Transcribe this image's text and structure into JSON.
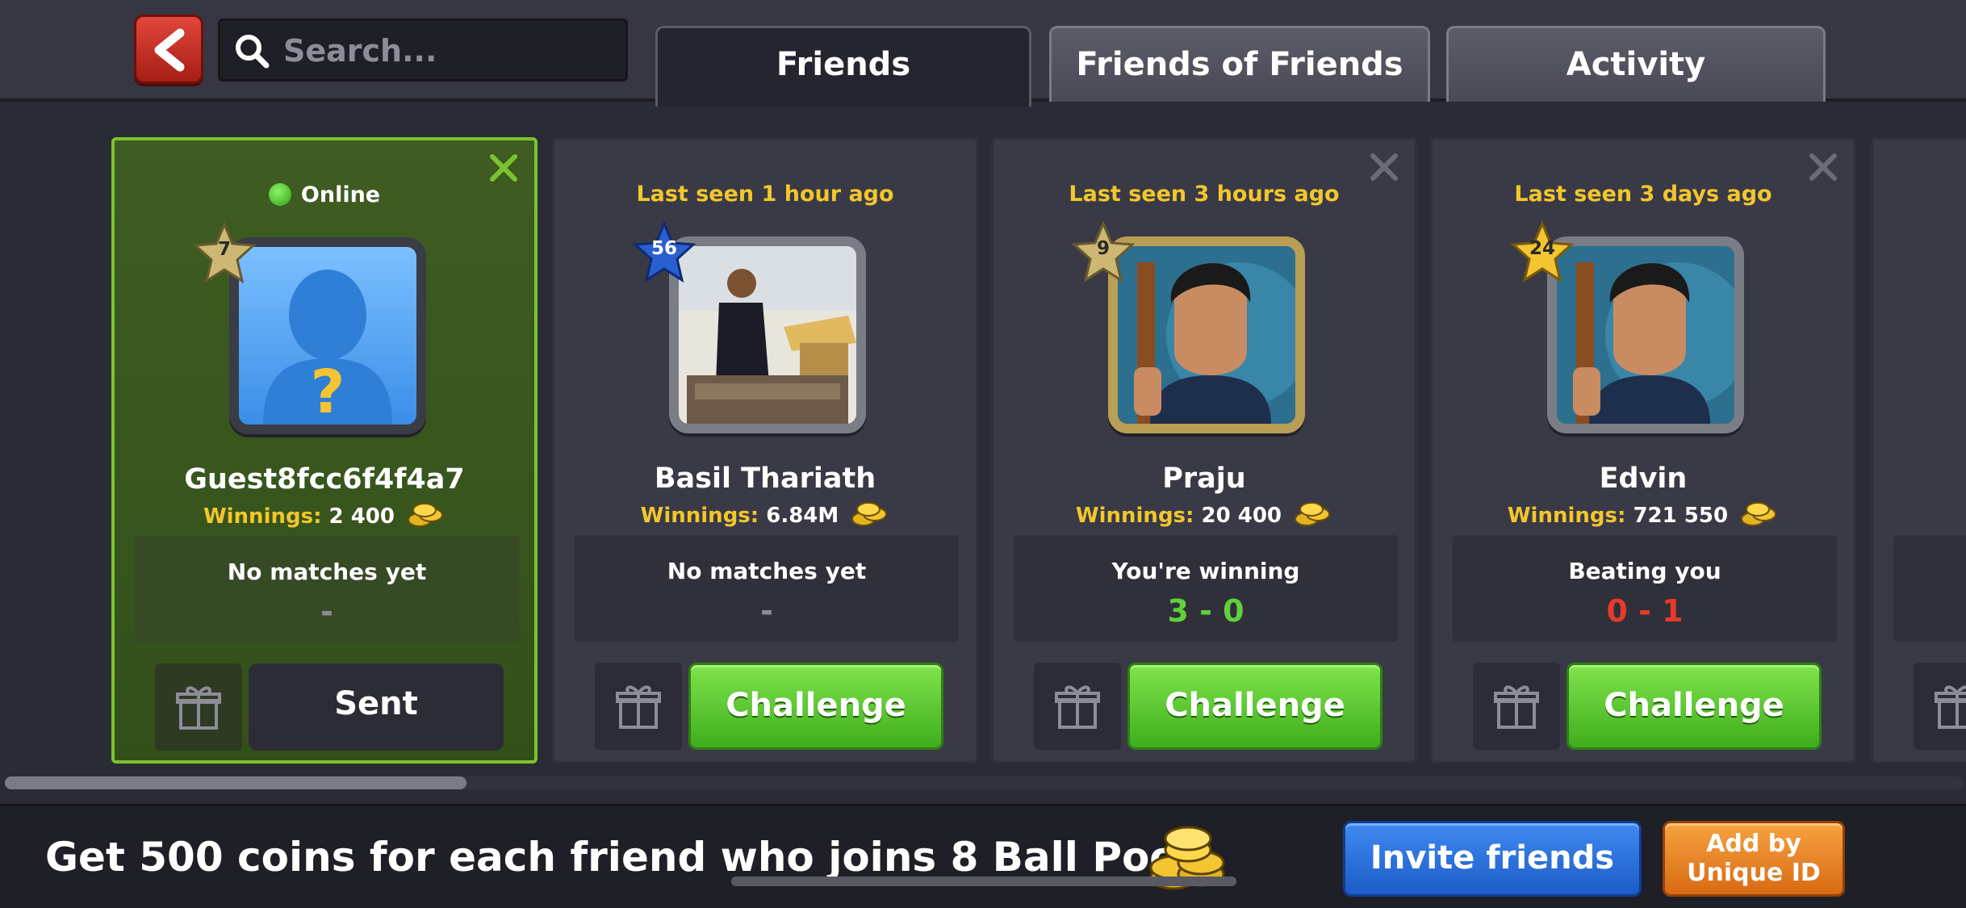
{
  "header": {
    "search_placeholder": "Search...",
    "tabs": [
      {
        "label": "Friends",
        "active": true
      },
      {
        "label": "Friends of Friends",
        "active": false
      },
      {
        "label": "Activity",
        "active": false
      }
    ]
  },
  "winnings_label": "Winnings:",
  "friends": [
    {
      "status": "Online",
      "online": true,
      "level": "7",
      "name": "Guest8fcc6f4f4a7",
      "winnings": "2 400",
      "record_text": "No matches yet",
      "record_score": "-",
      "action_label": "Sent"
    },
    {
      "status": "Last seen 1 hour ago",
      "online": false,
      "level": "56",
      "name": "Basil Thariath",
      "winnings": "6.84M",
      "record_text": "No matches yet",
      "record_score": "-",
      "action_label": "Challenge"
    },
    {
      "status": "Last seen 3 hours ago",
      "online": false,
      "level": "9",
      "name": "Praju",
      "winnings": "20 400",
      "record_text": "You're winning",
      "record_score": "3 - 0",
      "action_label": "Challenge"
    },
    {
      "status": "Last seen 3 days ago",
      "online": false,
      "level": "24",
      "name": "Edvin",
      "winnings": "721 550",
      "record_text": "Beating you",
      "record_score": "0 - 1",
      "action_label": "Challenge"
    }
  ],
  "footer": {
    "promo_text": "Get 500 coins for each friend who joins 8 Ball Pool!",
    "invite_label": "Invite friends",
    "unique_id_label": "Add by Unique ID"
  },
  "colors": {
    "accent_yellow": "#f2c72c",
    "online_green": "#7cc42e",
    "win_green": "#5fd13a",
    "lose_red": "#e53a2a",
    "invite_blue": "#2f74e0",
    "unique_orange": "#e8821f"
  },
  "icons": [
    "back-arrow-icon",
    "search-icon",
    "close-icon",
    "gift-icon",
    "coin-stack-icon",
    "level-star-icon",
    "online-dot-icon"
  ]
}
